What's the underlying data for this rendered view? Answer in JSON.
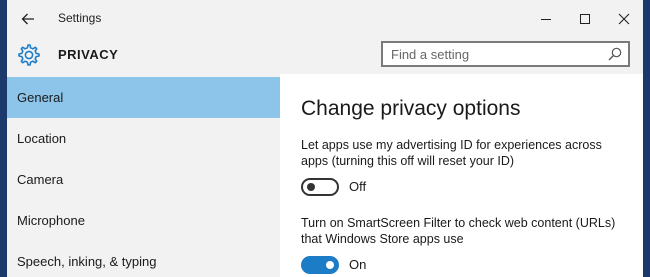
{
  "window": {
    "title": "Settings"
  },
  "header": {
    "title": "PRIVACY",
    "search_placeholder": "Find a setting"
  },
  "sidebar": {
    "items": [
      {
        "label": "General",
        "active": true
      },
      {
        "label": "Location",
        "active": false
      },
      {
        "label": "Camera",
        "active": false
      },
      {
        "label": "Microphone",
        "active": false
      },
      {
        "label": "Speech, inking, & typing",
        "active": false
      }
    ]
  },
  "content": {
    "title": "Change privacy options",
    "options": [
      {
        "description": "Let apps use my advertising ID for experiences across apps (turning this off will reset your ID)",
        "state_label": "Off",
        "enabled": false
      },
      {
        "description": "Turn on SmartScreen Filter to check web content (URLs) that Windows Store apps use",
        "state_label": "On",
        "enabled": true
      }
    ]
  },
  "colors": {
    "accent": "#1d7cc6",
    "nav_selected": "#8cc4ea",
    "chrome_background": "#f2f2f2"
  },
  "icons": {
    "back": "back-arrow-icon",
    "header": "gear-icon",
    "search": "search-icon"
  }
}
